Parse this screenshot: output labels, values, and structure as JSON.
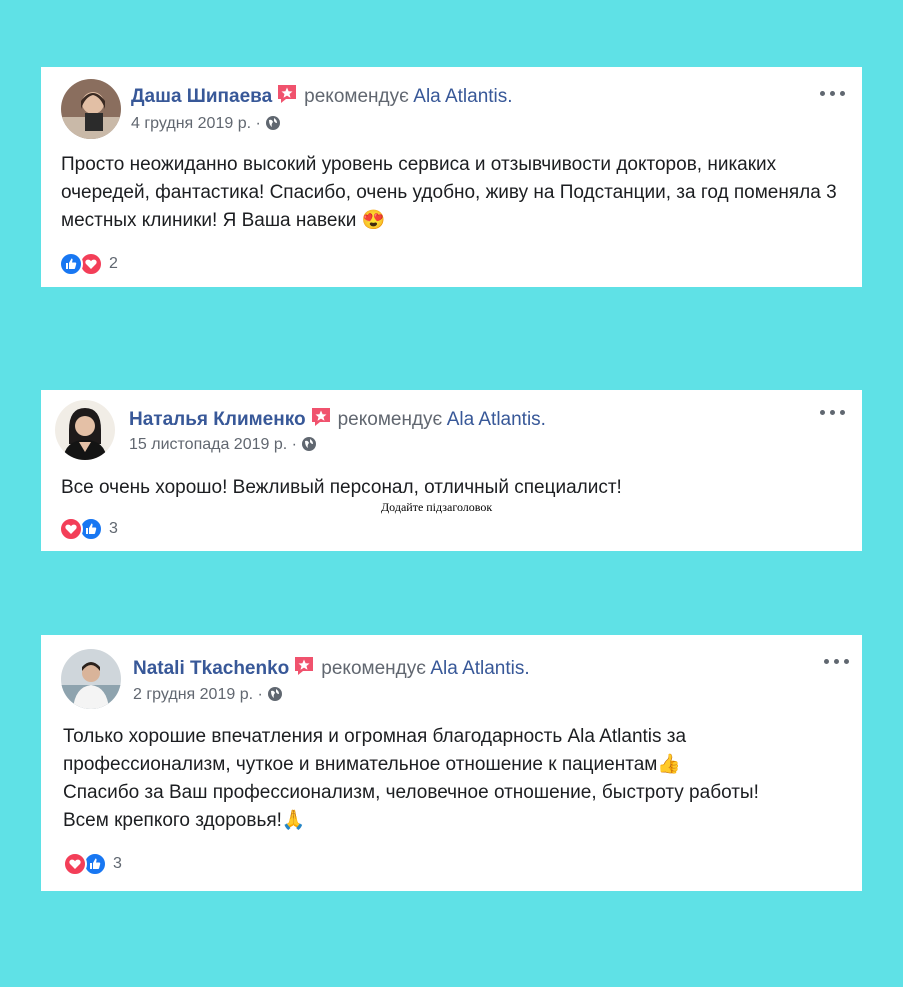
{
  "reviews": [
    {
      "name": "Даша Шипаева",
      "recommends": "рекомендує",
      "page": "Ala Atlantis.",
      "date": "4 грудня 2019 р. ·",
      "text": "Просто неожиданно высокий уровень сервиса и отзывчивости докторов, никаких очередей, фантастика! Спасибо, очень удобно, живу на Подстанции, за год поменяла 3 местных клиники! Я Ваша навеки",
      "emoji": "😍",
      "reaction_count": "2",
      "reactions": [
        "like-icon",
        "love-icon"
      ]
    },
    {
      "name": "Наталья Клименко",
      "recommends": "рекомендує",
      "page": "Ala Atlantis.",
      "date": "15 листопада 2019 р. ·",
      "text": "Все очень хорошо! Вежливый персонал, отличный специалист!",
      "reaction_count": "3",
      "reactions": [
        "love-icon",
        "like-icon"
      ]
    },
    {
      "name": "Natali Tkachenko",
      "recommends": "рекомендує",
      "page": "Ala Atlantis.",
      "date": "2 грудня 2019 р. ·",
      "text_lines": [
        "Только хорошие впечатления и огромная благодарность Ala Atlantis за",
        "профессионализм, чуткое и внимательное отношение к пациентам👍",
        "Спасибо за Ваш профессионализм, человечное отношение, быстроту работы!",
        "Всем крепкого здоровья!🙏"
      ],
      "reaction_count": "3",
      "reactions": [
        "love-icon",
        "like-icon"
      ]
    }
  ],
  "subheading": "Додайте підзаголовок",
  "colors": {
    "background": "#5fe1e6",
    "name": "#385898",
    "meta": "#616770",
    "like": "#1877f2",
    "love": "#f33e58",
    "badge": "#f0526d"
  }
}
